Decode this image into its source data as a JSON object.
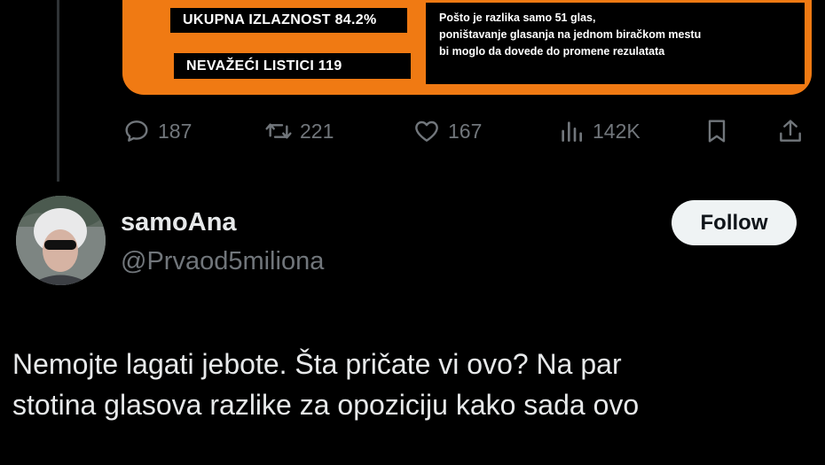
{
  "quoted_card": {
    "stat_turnout": "UKUPNA IZLAZNOST 84.2%",
    "stat_invalid": "NEVAŽEĆI LISTICI  119",
    "note_lines": [
      "Pošto je razlika samo 51 glas,",
      "poništavanje glasanja na jednom biračkom mestu",
      "bi moglo da dovede do promene rezulatata"
    ]
  },
  "actions": {
    "replies": "187",
    "reposts": "221",
    "likes": "167",
    "views": "142K"
  },
  "reply": {
    "display_name": "samoAna",
    "handle": "@Prvaod5miliona",
    "follow_label": "Follow",
    "text_lines": [
      "Nemojte lagati jebote.  Šta pričate vi ovo? Na par",
      "stotina glasova razlike za opoziciju kako sada ovo"
    ]
  },
  "colors": {
    "background": "#000000",
    "card_orange": "#f07a13",
    "muted": "#71767b",
    "text": "#e7e9ea"
  }
}
